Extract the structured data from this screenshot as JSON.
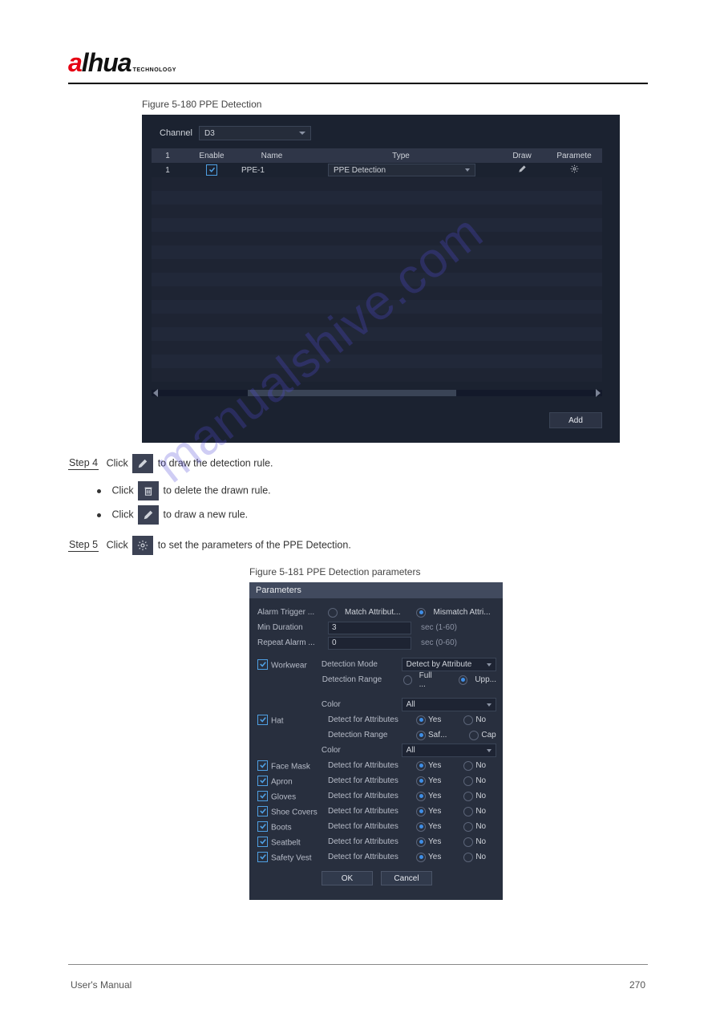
{
  "logo": {
    "a": "a",
    "rest": "lhua",
    "tech": "TECHNOLOGY"
  },
  "fig1_caption": "Figure 5-180 PPE Detection",
  "shot1": {
    "channel_label": "Channel",
    "channel_value": "D3",
    "headers": {
      "idx": "1",
      "enable": "Enable",
      "name": "Name",
      "type": "Type",
      "draw": "Draw",
      "param": "Paramete"
    },
    "row": {
      "idx": "1",
      "name": "PPE-1",
      "type": "PPE Detection"
    },
    "add": "Add"
  },
  "step4": {
    "num": "Step 4",
    "a": "Click",
    "b": "to draw the detection rule."
  },
  "bullets": {
    "b1a": "Click",
    "b1b": "to delete the drawn rule.",
    "b2a": "Click",
    "b2b": "to draw a new rule."
  },
  "step5": {
    "num": "Step 5",
    "a": "Click",
    "b": "to set the parameters of the PPE Detection."
  },
  "fig2_caption": "Figure 5-181 PPE Detection parameters",
  "shot2": {
    "title": "Parameters",
    "trigger_label": "Alarm Trigger ...",
    "match": "Match Attribut...",
    "mismatch": "Mismatch Attri...",
    "min_dur_label": "Min Duration",
    "min_dur_val": "3",
    "min_dur_hint": "sec (1-60)",
    "rep_label": "Repeat Alarm ...",
    "rep_val": "0",
    "rep_hint": "sec (0-60)",
    "workwear": "Workwear",
    "det_mode": "Detection Mode",
    "det_mode_val": "Detect by Attribute",
    "det_range": "Detection Range",
    "full": "Full ...",
    "upp": "Upp...",
    "color": "Color",
    "color_all": "All",
    "hat": "Hat",
    "dfa": "Detect for Attributes",
    "yes": "Yes",
    "no": "No",
    "saf": "Saf...",
    "cap": "Cap",
    "facemask": "Face Mask",
    "apron": "Apron",
    "gloves": "Gloves",
    "shoe": "Shoe Covers",
    "boots": "Boots",
    "seatbelt": "Seatbelt",
    "vest": "Safety Vest",
    "ok": "OK",
    "cancel": "Cancel"
  },
  "watermark": "manualshive.com",
  "footer": {
    "um": "User's Manual",
    "pg": "270"
  }
}
